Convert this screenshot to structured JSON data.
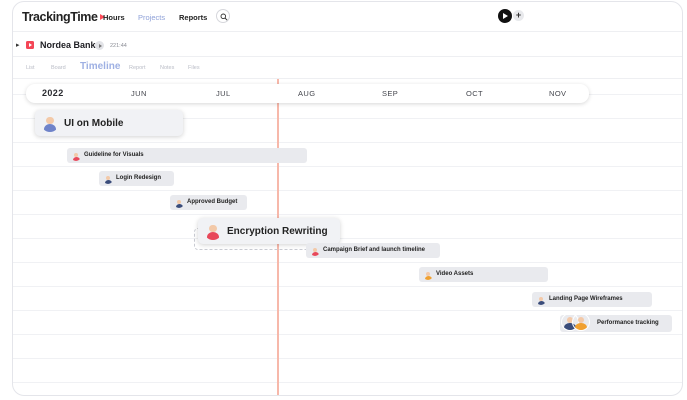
{
  "app": {
    "logo_text": "TrackingTime",
    "nav": {
      "hours": "Hours",
      "projects": "Projects",
      "reports": "Reports"
    }
  },
  "project": {
    "name": "Nordea Bank",
    "time": "221:44"
  },
  "tabs": [
    "List",
    "Board",
    "Timeline",
    "Report",
    "Notes",
    "Files"
  ],
  "timeline": {
    "year": "2022",
    "months": [
      "JUN",
      "JUL",
      "AUG",
      "SEP",
      "OCT",
      "NOV"
    ]
  },
  "tasks": [
    {
      "label": "UI on Mobile",
      "avatar_color": "#6f83c9"
    },
    {
      "label": "Guideline for Visuals",
      "avatar_color": "#e8485a"
    },
    {
      "label": "Login Redesign",
      "avatar_color": "#3a4c7a"
    },
    {
      "label": "Approved Budget",
      "avatar_color": "#3a4c7a"
    },
    {
      "label": "Encryption Rewriting",
      "avatar_color": "#e8485a"
    },
    {
      "label": "Campaign Brief and launch timeline",
      "avatar_color": "#e8485a"
    },
    {
      "label": "Video Assets",
      "avatar_color": "#f0a030"
    },
    {
      "label": "Landing Page Wireframes",
      "avatar_color": "#3a4c7a"
    },
    {
      "label": "Performance tracking",
      "avatar_color": "#f0a030"
    }
  ],
  "colors": {
    "accent": "#ff4d5a",
    "today_line": "#f7b8aa",
    "tab_active": "#9eb0e3"
  }
}
